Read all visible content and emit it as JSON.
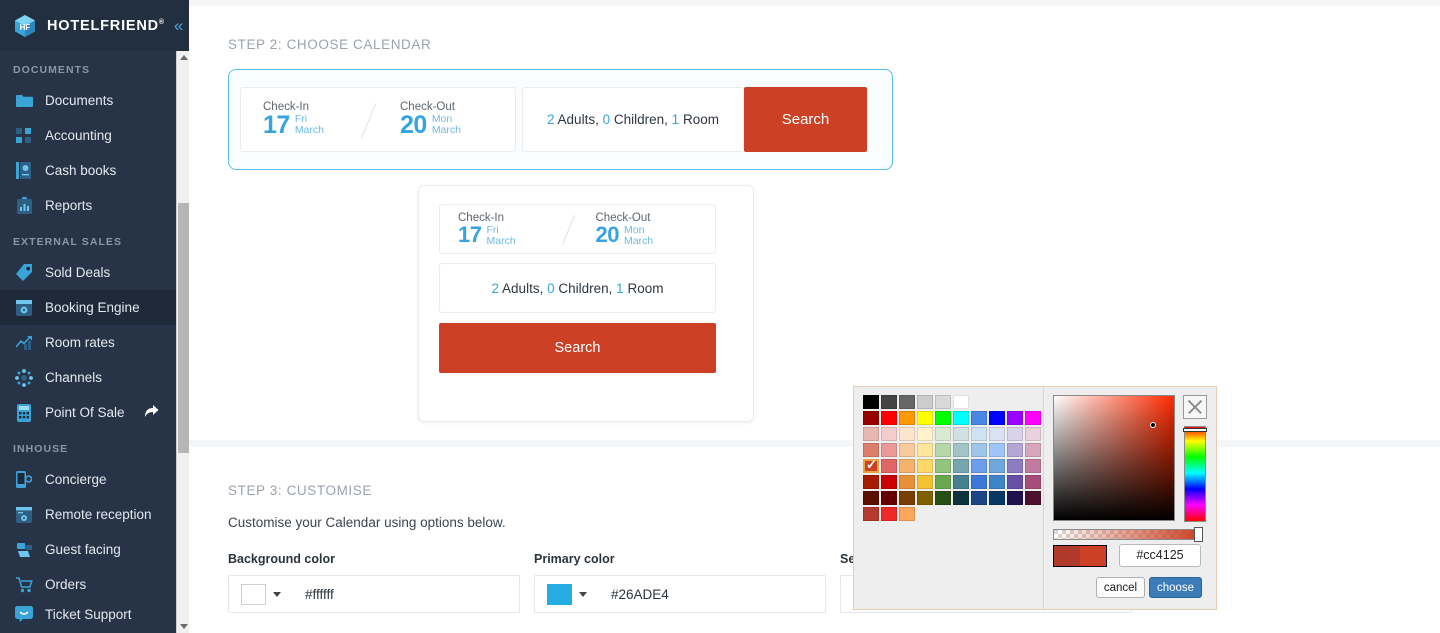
{
  "brand": {
    "name": "HOTELFRIEND",
    "trademark": "®",
    "collapse_icon": "chevron-double-left"
  },
  "sidebar": {
    "sections": [
      {
        "title": "DOCUMENTS",
        "items": [
          {
            "label": "Documents",
            "icon": "folder-icon"
          },
          {
            "label": "Accounting",
            "icon": "grid-squares-icon"
          },
          {
            "label": "Cash books",
            "icon": "cash-book-icon"
          },
          {
            "label": "Reports",
            "icon": "clipboard-chart-icon"
          }
        ]
      },
      {
        "title": "EXTERNAL SALES",
        "items": [
          {
            "label": "Sold Deals",
            "icon": "tag-icon"
          },
          {
            "label": "Booking Engine",
            "icon": "booking-engine-icon",
            "active": true
          },
          {
            "label": "Room rates",
            "icon": "chart-up-icon"
          },
          {
            "label": "Channels",
            "icon": "channels-network-icon"
          },
          {
            "label": "Point Of Sale",
            "icon": "pos-terminal-icon",
            "external": true,
            "external_icon": "external-link-icon"
          }
        ]
      },
      {
        "title": "INHOUSE",
        "items": [
          {
            "label": "Concierge",
            "icon": "concierge-phone-icon"
          },
          {
            "label": "Remote reception",
            "icon": "remote-reception-icon"
          },
          {
            "label": "Guest facing",
            "icon": "guest-facing-icon"
          },
          {
            "label": "Orders",
            "icon": "shopping-cart-icon"
          }
        ]
      }
    ],
    "pinned": {
      "label": "Ticket Support",
      "icon": "chat-smile-icon"
    }
  },
  "step2": {
    "title": "STEP 2: CHOOSE CALENDAR",
    "widget": {
      "checkin_label": "Check-In",
      "checkin_day": "17",
      "checkin_weekday": "Fri",
      "checkin_month": "March",
      "checkout_label": "Check-Out",
      "checkout_day": "20",
      "checkout_weekday": "Mon",
      "checkout_month": "March",
      "guests": {
        "adults_count": "2",
        "adults_label": "Adults,",
        "children_count": "0",
        "children_label": "Children,",
        "rooms_count": "1",
        "rooms_label": "Room"
      },
      "search_label": "Search"
    }
  },
  "step3": {
    "title": "STEP 3: CUSTOMISE",
    "description": "Customise your Calendar using options below.",
    "fields": [
      {
        "label": "Background color",
        "value": "#ffffff",
        "swatch": "#ffffff"
      },
      {
        "label": "Primary color",
        "value": "#26ADE4",
        "swatch": "#26ADE4"
      },
      {
        "label": "Se",
        "value": "",
        "swatch": "#ffffff"
      }
    ]
  },
  "picker": {
    "hex_value": "#cc4125",
    "cancel_label": "cancel",
    "choose_label": "choose",
    "close_icon": "close-x-icon",
    "preview_old": "#b03a2a",
    "preview_new": "#cc4125",
    "selected_swatch": "#cc4125",
    "swatch_rows": [
      [
        "#000000",
        "#434343",
        "#666666",
        "#cccccc",
        "#d9d9d9",
        "#ffffff"
      ],
      [
        "#980000",
        "#ff0000",
        "#ff9900",
        "#ffff00",
        "#00ff00",
        "#00ffff",
        "#4a86e8",
        "#0000ff",
        "#9900ff",
        "#ff00ff"
      ],
      [
        "#e6b8af",
        "#f4cccc",
        "#fce5cd",
        "#fff2cc",
        "#d9ead3",
        "#d0e0e3",
        "#cfe2f3",
        "#d9e2f3",
        "#d9d2e9",
        "#ead1dc"
      ],
      [
        "#dd7e6b",
        "#ea9999",
        "#f9cb9c",
        "#ffe599",
        "#b6d7a8",
        "#a2c4c9",
        "#9fc5e8",
        "#9fc5f8",
        "#b4a7d6",
        "#d5a6bd"
      ],
      [
        "#cc4125",
        "#e06666",
        "#f6b26b",
        "#ffd966",
        "#93c47d",
        "#76a5af",
        "#6d9eeb",
        "#6fa8dc",
        "#8e7cc3",
        "#c27ba0"
      ],
      [
        "#a61c00",
        "#cc0000",
        "#e69138",
        "#f1c232",
        "#6aa84f",
        "#45818e",
        "#3c78d8",
        "#3d85c6",
        "#674ea7",
        "#a64d79"
      ],
      [
        "#5b0f00",
        "#660000",
        "#783f04",
        "#7f6000",
        "#274e13",
        "#0c343d",
        "#1c4587",
        "#073763",
        "#20124d",
        "#4c1130"
      ],
      [
        "#b5392d",
        "#ef2929",
        "#faa75b"
      ]
    ]
  }
}
